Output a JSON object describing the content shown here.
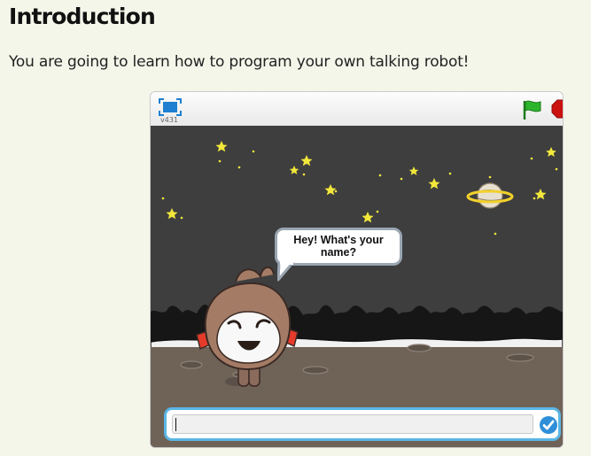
{
  "page": {
    "title": "Introduction",
    "intro": "You are going to learn how to program your own talking robot!"
  },
  "player": {
    "version": "v431",
    "fullscreen_icon": "fullscreen-icon",
    "flag_icon": "green-flag-icon",
    "stop_icon": "stop-sign-icon",
    "speech_text": "Hey! What's your name?",
    "answer": {
      "value": "",
      "submit_icon": "checkmark-icon"
    },
    "colors": {
      "stage_sky": "#3e3e3f",
      "ground": "#6f6358",
      "answer_border": "#5ab6e6",
      "flag": "#2cb52c",
      "stop": "#cc1111"
    }
  }
}
